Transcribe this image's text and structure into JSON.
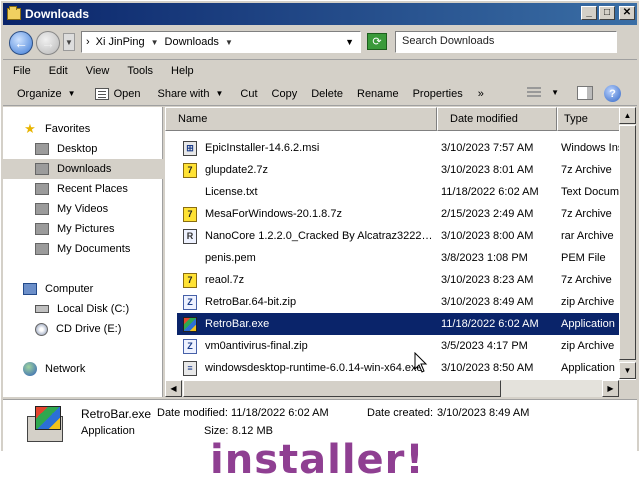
{
  "window": {
    "title": "Downloads"
  },
  "title_buttons": {
    "minimize": "_",
    "maximize": "□",
    "close": "✕"
  },
  "address": {
    "crumbs": [
      "Xi JinPing",
      "Downloads"
    ],
    "search_placeholder": "Search Downloads"
  },
  "menu": [
    "File",
    "Edit",
    "View",
    "Tools",
    "Help"
  ],
  "toolbar": {
    "organize": "Organize",
    "open": "Open",
    "share_with": "Share with",
    "cut": "Cut",
    "copy": "Copy",
    "delete": "Delete",
    "rename": "Rename",
    "properties": "Properties",
    "more": "»"
  },
  "nav": {
    "favorites": "Favorites",
    "desktop": "Desktop",
    "downloads": "Downloads",
    "recent_places": "Recent Places",
    "my_videos": "My Videos",
    "my_pictures": "My Pictures",
    "my_documents": "My Documents",
    "computer": "Computer",
    "local_disk": "Local Disk (C:)",
    "cd_drive": "CD Drive (E:)",
    "network": "Network"
  },
  "columns": {
    "name": "Name",
    "date_modified": "Date modified",
    "type": "Type"
  },
  "files": [
    {
      "name": "EpicInstaller-14.6.2.msi",
      "date": "3/10/2023 7:57 AM",
      "type": "Windows Ins",
      "icon": "msi-icon"
    },
    {
      "name": "glupdate2.7z",
      "date": "3/10/2023 8:01 AM",
      "type": "7z Archive",
      "icon": "7z-icon"
    },
    {
      "name": "License.txt",
      "date": "11/18/2022 6:02 AM",
      "type": "Text Docume",
      "icon": "none"
    },
    {
      "name": "MesaForWindows-20.1.8.7z",
      "date": "2/15/2023 2:49 AM",
      "type": "7z Archive",
      "icon": "7z-icon"
    },
    {
      "name": "NanoCore 1.2.2.0_Cracked By Alcatraz3222…",
      "date": "3/10/2023 8:00 AM",
      "type": "rar Archive",
      "icon": "rar-icon"
    },
    {
      "name": "penis.pem",
      "date": "3/8/2023 1:08 PM",
      "type": "PEM File",
      "icon": "none"
    },
    {
      "name": "reaol.7z",
      "date": "3/10/2023 8:23 AM",
      "type": "7z Archive",
      "icon": "7z-icon"
    },
    {
      "name": "RetroBar.64-bit.zip",
      "date": "3/10/2023 8:49 AM",
      "type": "zip Archive",
      "icon": "zip-icon"
    },
    {
      "name": "RetroBar.exe",
      "date": "11/18/2022 6:02 AM",
      "type": "Application",
      "icon": "exe-icon",
      "selected": true
    },
    {
      "name": "vm0antivirus-final.zip",
      "date": "3/5/2023 4:17 PM",
      "type": "zip Archive",
      "icon": "zip-icon"
    },
    {
      "name": "windowsdesktop-runtime-6.0.14-win-x64.exe",
      "date": "3/10/2023 8:50 AM",
      "type": "Application",
      "icon": "installer-icon"
    }
  ],
  "details": {
    "name": "RetroBar.exe",
    "type": "Application",
    "date_modified_label": "Date modified:",
    "date_modified": "11/18/2022 6:02 AM",
    "date_created_label": "Date created:",
    "date_created": "3/10/2023 8:49 AM",
    "size_label": "Size:",
    "size": "8.12 MB"
  },
  "overlay_text": "installer!",
  "colors": {
    "title_bar": "#0a246a",
    "selection": "#0a246a",
    "overlay": "#8f3f92",
    "chrome": "#d4d0c8"
  }
}
